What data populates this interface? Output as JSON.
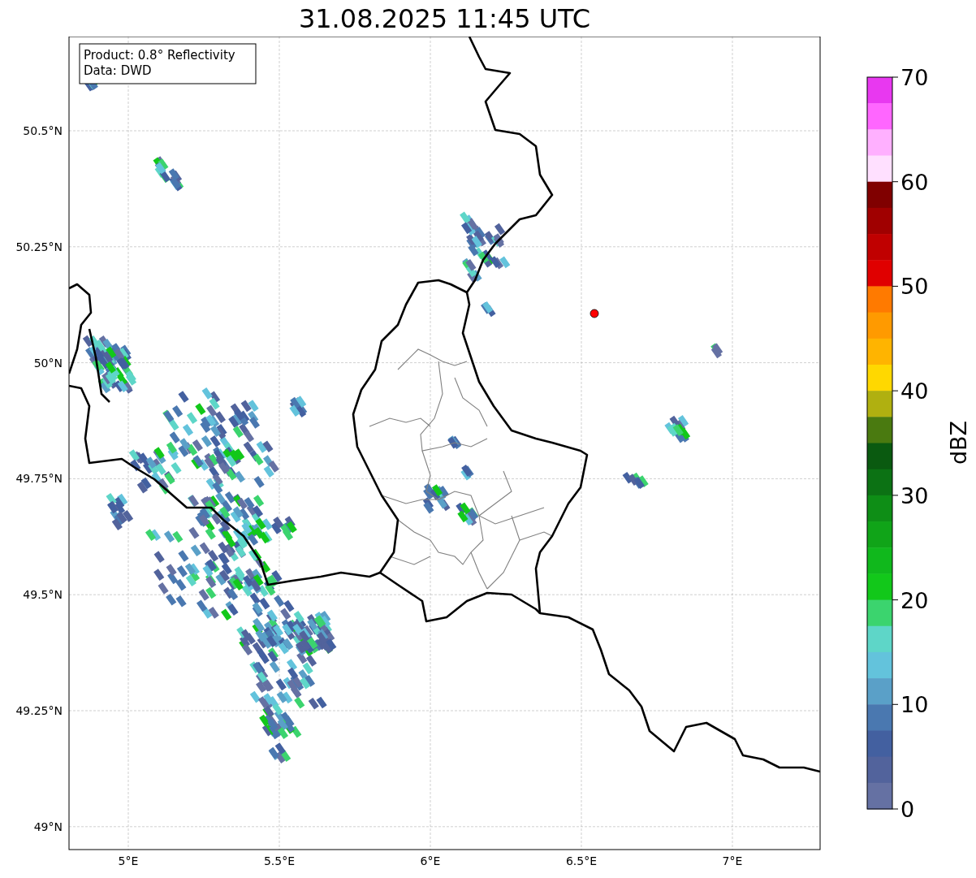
{
  "title": "31.08.2025 11:45 UTC",
  "info_box": {
    "lines": [
      "Product: 0.8° Reflectivity",
      "Data: DWD"
    ]
  },
  "map": {
    "lat_ticks": [
      "50.5°N",
      "50.25°N",
      "50°N",
      "49.75°N",
      "49.5°N",
      "49.25°N",
      "49°N"
    ],
    "lon_ticks": [
      "5°E",
      "5.5°E",
      "6°E",
      "6.5°E",
      "7°E"
    ]
  },
  "colorbar": {
    "label": "dBZ",
    "ticks": [
      "70",
      "60",
      "50",
      "40",
      "30",
      "20",
      "10",
      "0"
    ],
    "segments": [
      {
        "color": "#e838f0"
      },
      {
        "color": "#ff66ff"
      },
      {
        "color": "#ffb0ff"
      },
      {
        "color": "#ffe0ff"
      },
      {
        "color": "#800000"
      },
      {
        "color": "#a00000"
      },
      {
        "color": "#c00000"
      },
      {
        "color": "#e00000"
      },
      {
        "color": "#ff7a00"
      },
      {
        "color": "#ff9a00"
      },
      {
        "color": "#ffb400"
      },
      {
        "color": "#ffd800"
      },
      {
        "color": "#b0b010"
      },
      {
        "color": "#4a7a10"
      },
      {
        "color": "#0a5a10"
      },
      {
        "color": "#0c7214"
      },
      {
        "color": "#0e8e16"
      },
      {
        "color": "#10a418"
      },
      {
        "color": "#10b81c"
      },
      {
        "color": "#12c81a"
      },
      {
        "color": "#3bd46e"
      },
      {
        "color": "#5ed6c8"
      },
      {
        "color": "#63c3dc"
      },
      {
        "color": "#5aa0c8"
      },
      {
        "color": "#4a78b0"
      },
      {
        "color": "#4360a0"
      },
      {
        "color": "#52639c"
      },
      {
        "color": "#6571a3"
      }
    ]
  }
}
